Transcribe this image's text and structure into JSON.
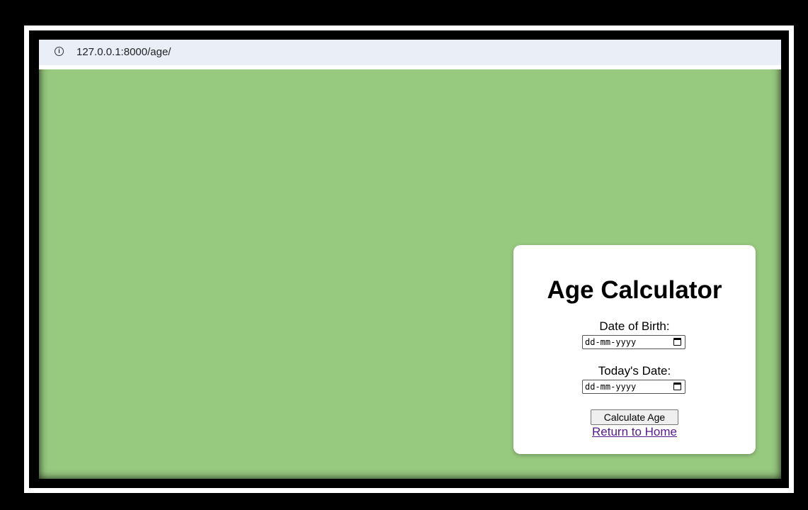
{
  "browser": {
    "url": "127.0.0.1:8000/age/",
    "info_icon": "info-icon"
  },
  "card": {
    "title": "Age Calculator",
    "dob_label": "Date of Birth:",
    "dob_value": "dd-mm-yyyy",
    "today_label": "Today's Date:",
    "today_value": "dd-mm-yyyy",
    "calendar_icon": "calendar-icon",
    "button_label": "Calculate Age",
    "link_label": "Return to Home"
  },
  "colors": {
    "page_background": "#97c97f",
    "card_background": "#ffffff",
    "link_color": "#551a8b"
  }
}
